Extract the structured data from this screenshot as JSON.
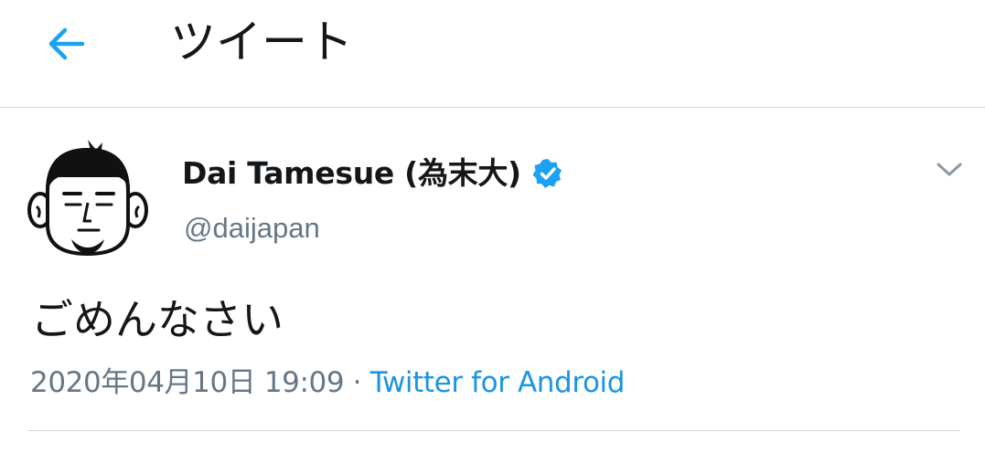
{
  "header": {
    "title": "ツイート",
    "back_icon": "arrow-left-icon"
  },
  "tweet": {
    "author": {
      "display_name": "Dai Tamesue (為末大)",
      "handle": "@daijapan",
      "verified": true,
      "verified_icon": "verified-badge-icon"
    },
    "menu_icon": "chevron-down-icon",
    "text": "ごめんなさい",
    "timestamp": "2020年04月10日 19:09",
    "separator": " · ",
    "source": "Twitter for Android"
  },
  "colors": {
    "accent": "#1da1f2",
    "source_link": "#1b95e0",
    "secondary_text": "#657786",
    "divider": "#d6d9dc"
  }
}
